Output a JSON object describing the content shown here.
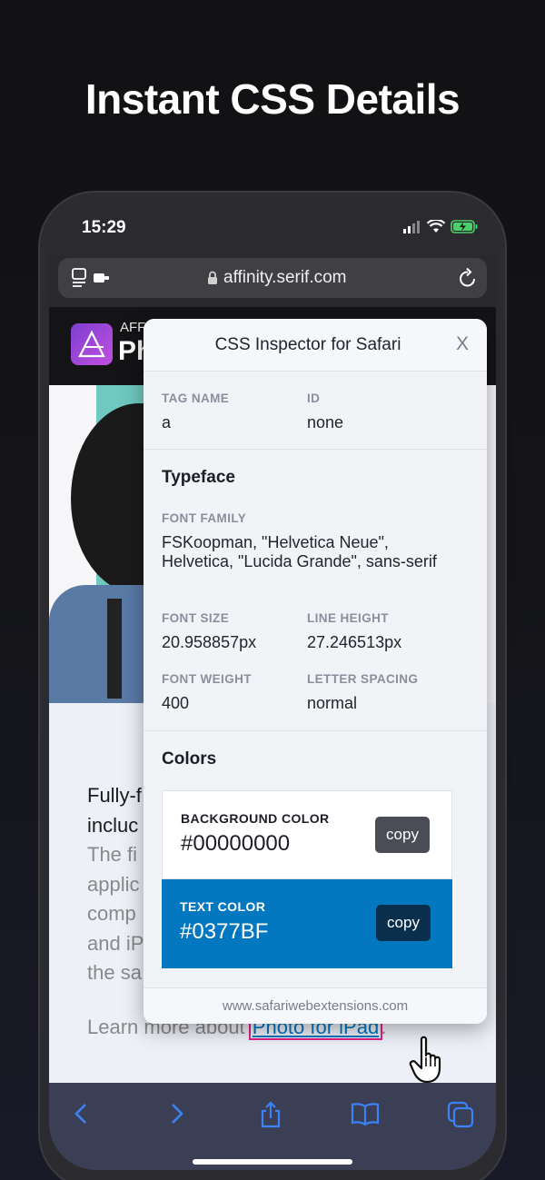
{
  "headline": "Instant CSS Details",
  "status": {
    "time": "15:29"
  },
  "browser": {
    "url": "affinity.serif.com"
  },
  "site": {
    "logo_small": "AFF",
    "logo_big": "Ph",
    "body_lines_dark": [
      "Fully-f",
      "incluc"
    ],
    "body_lines_grey": [
      "The fi",
      "applic",
      "comp",
      "and iP",
      "the sa"
    ],
    "learn_prefix": "Learn more about ",
    "learn_link": "Photo for iPad",
    "learn_suffix": "."
  },
  "inspector": {
    "title": "CSS Inspector for Safari",
    "close_label": "X",
    "tag_name_label": "TAG NAME",
    "tag_name_value": "a",
    "id_label": "ID",
    "id_value": "none",
    "typeface_heading": "Typeface",
    "font_family_label": "FONT FAMILY",
    "font_family_value": "FSKoopman, \"Helvetica Neue\", Helvetica, \"Lucida Grande\", sans-serif",
    "font_size_label": "FONT SIZE",
    "font_size_value": "20.958857px",
    "line_height_label": "LINE HEIGHT",
    "line_height_value": "27.246513px",
    "font_weight_label": "FONT WEIGHT",
    "font_weight_value": "400",
    "letter_spacing_label": "LETTER SPACING",
    "letter_spacing_value": "normal",
    "colors_heading": "Colors",
    "bg_color_label": "BACKGROUND COLOR",
    "bg_color_value": "#00000000",
    "text_color_label": "TEXT COLOR",
    "text_color_value": "#0377BF",
    "copy_label": "copy",
    "footer": "www.safariwebextensions.com"
  },
  "colors": {
    "link": "#0377bf",
    "highlight": "#e0218a",
    "accent": "#0377BF"
  },
  "icons": [
    "reader-icon",
    "lock-icon",
    "reload-icon",
    "back-icon",
    "forward-icon",
    "share-icon",
    "bookmarks-icon",
    "tabs-icon",
    "pointer-hand-icon"
  ]
}
